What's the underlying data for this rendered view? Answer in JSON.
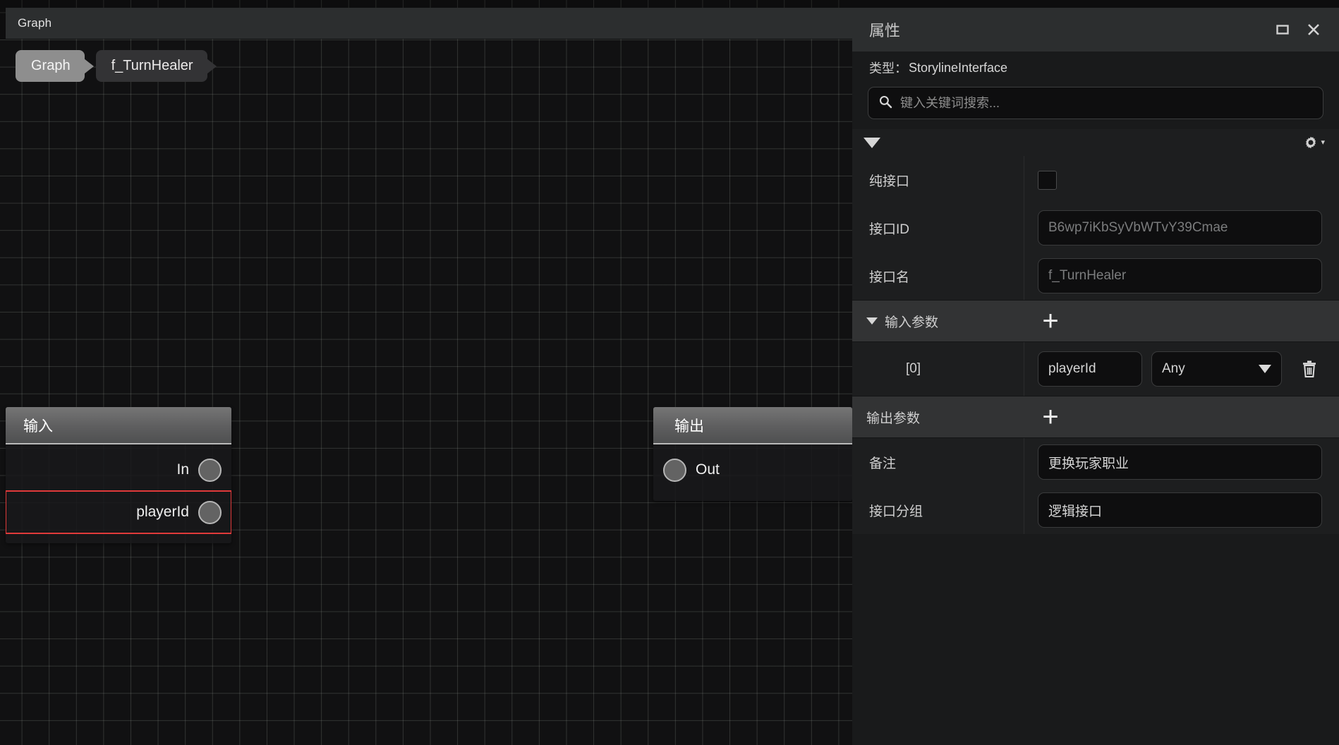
{
  "graph": {
    "titlebar_label": "Graph",
    "breadcrumb": [
      {
        "label": "Graph",
        "active": true
      },
      {
        "label": "f_TurnHealer",
        "active": false
      }
    ],
    "nodes": {
      "input": {
        "title": "输入",
        "ports": [
          {
            "label": "In",
            "highlighted": false
          },
          {
            "label": "playerId",
            "highlighted": true
          }
        ]
      },
      "output": {
        "title": "输出",
        "ports": [
          {
            "label": "Out",
            "highlighted": false
          }
        ]
      }
    }
  },
  "properties": {
    "title": "属性",
    "window_buttons": {
      "maximize": "maximize-icon",
      "close": "close-icon"
    },
    "type_label": "类型：",
    "type_value": "StorylineInterface",
    "search": {
      "placeholder": "键入关键词搜索...",
      "value": "",
      "icon": "search-icon"
    },
    "gear_icon": "gear-icon",
    "rows": {
      "pure_interface": {
        "label": "纯接口",
        "checked": false
      },
      "interface_id": {
        "label": "接口ID",
        "value": "B6wp7iKbSyVbWTvY39Cmae"
      },
      "interface_name": {
        "label": "接口名",
        "value": "f_TurnHealer"
      },
      "remark": {
        "label": "备注",
        "value": "更换玩家职业"
      },
      "interface_group": {
        "label": "接口分组",
        "value": "逻辑接口"
      }
    },
    "input_params": {
      "label": "输入参数",
      "add_label": "+",
      "items": [
        {
          "index": "[0]",
          "name": "playerId",
          "type": "Any",
          "delete_icon": "trash-icon"
        }
      ]
    },
    "output_params": {
      "label": "输出参数",
      "add_label": "+",
      "items": []
    }
  },
  "colors": {
    "panel_bg": "#1d1e1f",
    "titlebar_bg": "#2c2e2f",
    "section_bg": "#323334",
    "field_bg": "#0e0e0f",
    "highlight_red": "#e03a3a",
    "canvas_bg": "#111112"
  }
}
